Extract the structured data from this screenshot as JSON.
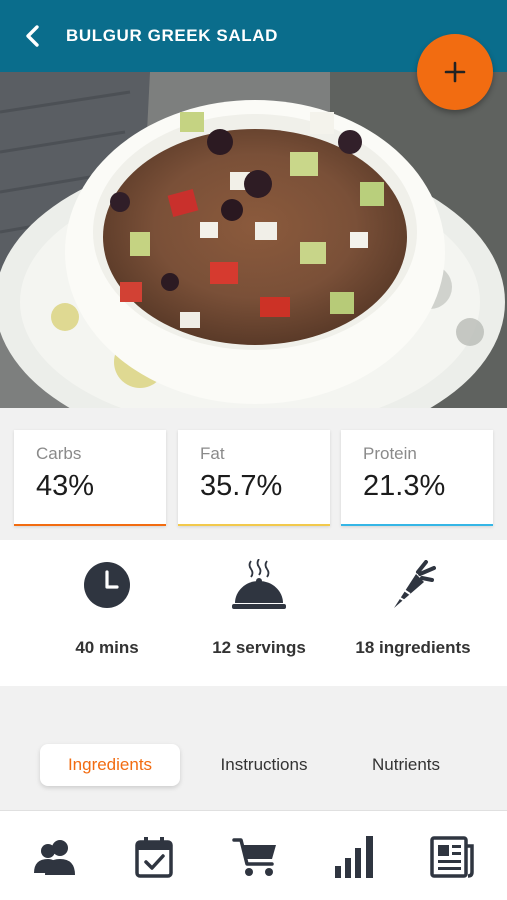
{
  "header": {
    "title": "BULGUR GREEK SALAD",
    "back_icon": "back-arrow-icon"
  },
  "fab": {
    "icon": "plus-icon"
  },
  "macros": [
    {
      "label": "Carbs",
      "value": "43%",
      "color": "#f26c11"
    },
    {
      "label": "Fat",
      "value": "35.7%",
      "color": "#f2c94c"
    },
    {
      "label": "Protein",
      "value": "21.3%",
      "color": "#35b6e6"
    }
  ],
  "stats": [
    {
      "icon": "clock-icon",
      "text": "40 mins"
    },
    {
      "icon": "serving-dish-icon",
      "text": "12 servings"
    },
    {
      "icon": "carrot-icon",
      "text": "18 ingredients"
    }
  ],
  "tabs": [
    {
      "label": "Ingredients",
      "active": true
    },
    {
      "label": "Instructions",
      "active": false
    },
    {
      "label": "Nutrients",
      "active": false
    }
  ],
  "bottom_nav": [
    {
      "icon": "profile-icon"
    },
    {
      "icon": "calendar-check-icon"
    },
    {
      "icon": "cart-icon"
    },
    {
      "icon": "bar-chart-icon"
    },
    {
      "icon": "news-icon"
    }
  ],
  "colors": {
    "header_bg": "#0a6d8c",
    "accent": "#f26c11"
  }
}
